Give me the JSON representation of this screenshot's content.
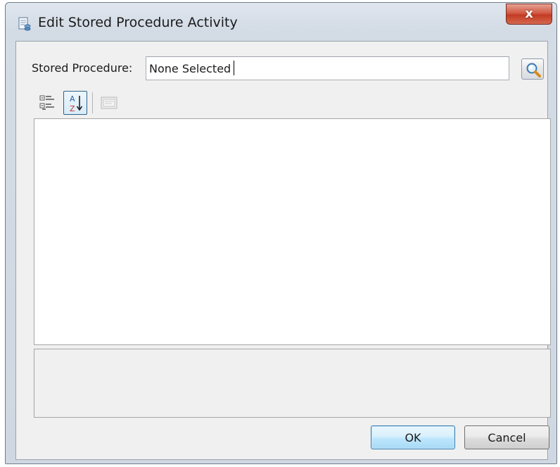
{
  "window": {
    "title": "Edit Stored Procedure Activity",
    "close_label": "x",
    "title_icon": "stored-procedure-icon"
  },
  "stored_procedure": {
    "label": "Stored Procedure:",
    "value": "None Selected",
    "search_icon": "search-icon"
  },
  "toolbar": {
    "categorized_icon": "categorized-view-icon",
    "alphabetical_icon": "alphabetical-sort-icon",
    "pages_icon": "property-pages-icon",
    "alpha_top": "A",
    "alpha_bottom": "Z"
  },
  "buttons": {
    "ok_label": "OK",
    "cancel_label": "Cancel"
  },
  "colors": {
    "close_red": "#c33a23",
    "ok_border": "#3c7fb1",
    "client_bg": "#f0f0f0"
  }
}
